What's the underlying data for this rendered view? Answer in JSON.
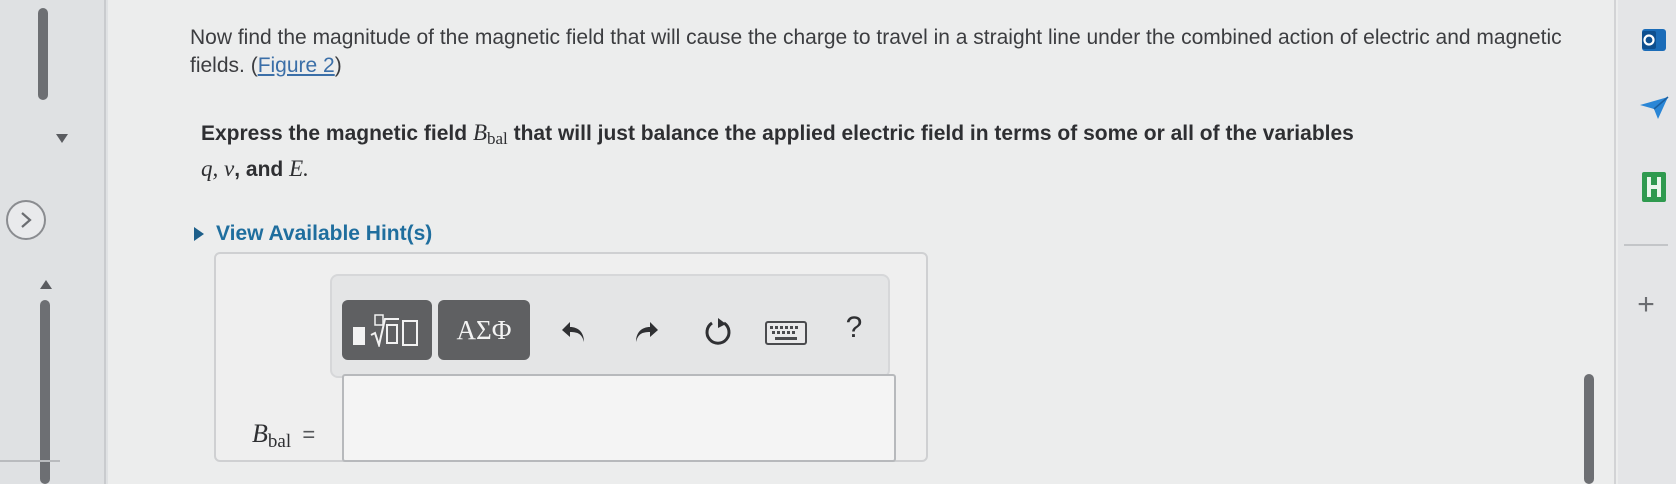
{
  "question": {
    "text_before": "Now find the magnitude of the magnetic field that will cause the charge to travel in a straight line under the combined action of electric and magnetic fields. (",
    "figure_link": "Figure 2",
    "text_after": ")"
  },
  "instruction": {
    "part1": "Express the magnetic field ",
    "var_B": "B",
    "var_sub": "bal",
    "part2": " that will just balance the applied electric field in terms of some or all of the variables",
    "var_q": "q",
    "comma1": ", ",
    "var_v": "v",
    "part3": ", and ",
    "var_E": "E",
    "period": "."
  },
  "hint": {
    "label": "View Available Hint(s)"
  },
  "toolbar": {
    "greek_label": "ΑΣΦ",
    "help_label": "?"
  },
  "answer": {
    "label_var": "B",
    "label_sub": "bal",
    "equals": "=",
    "value": ""
  },
  "sidebar_right": {
    "plus": "+"
  },
  "colors": {
    "link": "#3b6fa8",
    "hint": "#1f6e9e",
    "toolbar_button": "#5f6062"
  }
}
